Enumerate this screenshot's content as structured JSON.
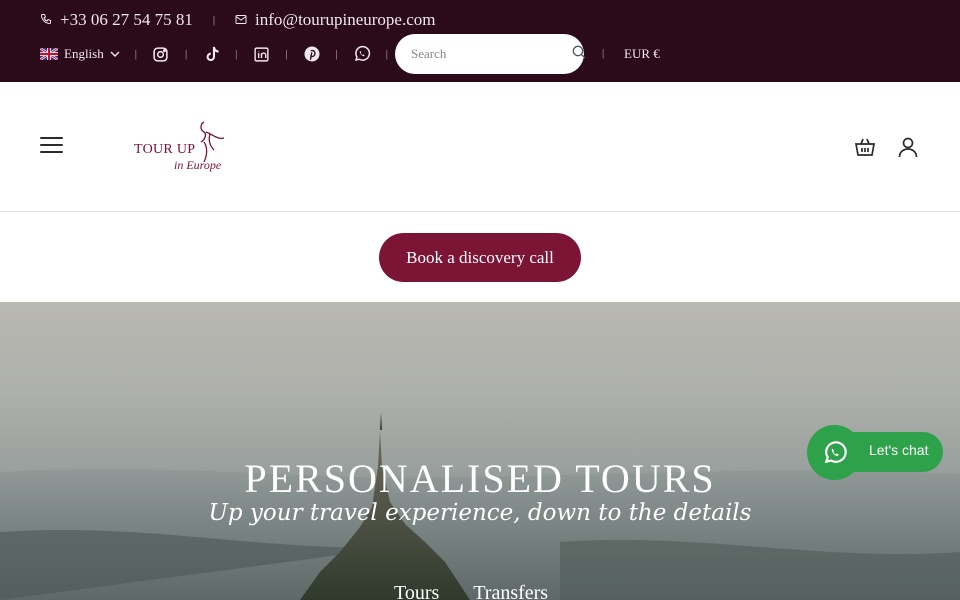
{
  "topbar": {
    "phone": "+33 06 27 54 75 81",
    "email": "info@tourupineurope.com",
    "language": "English",
    "search_placeholder": "Search",
    "currency": "EUR €",
    "social_icons": [
      "instagram-icon",
      "tiktok-icon",
      "linkedin-icon",
      "pinterest-icon",
      "whatsapp-icon"
    ]
  },
  "header": {
    "logo_line1": "TOUR UP",
    "logo_line2": "in Europe"
  },
  "cta": {
    "label": "Book a discovery call"
  },
  "hero": {
    "title": "PERSONALISED TOURS",
    "subtitle": "Up your travel experience, down to the details",
    "tabs": [
      "Tours",
      "Transfers"
    ]
  },
  "chat": {
    "label": "Let's chat"
  },
  "colors": {
    "topbar_bg": "#2b0a1a",
    "brand": "#7c1535",
    "chat_green": "#2ea24a"
  }
}
